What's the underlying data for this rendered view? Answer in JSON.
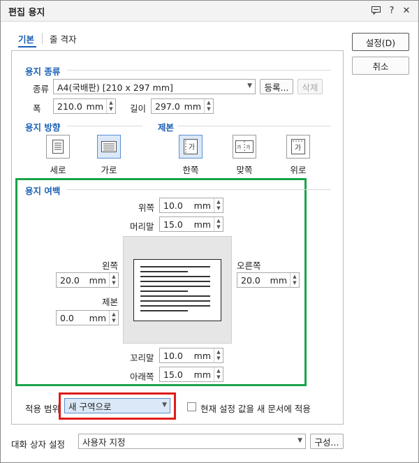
{
  "window": {
    "title": "편집 용지"
  },
  "titlebar_buttons": {
    "help": "?",
    "close": "✕"
  },
  "tabs": [
    {
      "label": "기본"
    },
    {
      "label": "줄 격자"
    }
  ],
  "paper_type": {
    "section": "용지 종류",
    "type_label": "종류",
    "type_value": "A4(국배판)  [210 x 297 mm]",
    "register_button": "등록...",
    "delete_button": "삭제",
    "width_label": "폭",
    "width_value": "210.0",
    "height_label": "길이",
    "height_value": "297.0",
    "unit": "mm"
  },
  "orientation": {
    "section": "용지 방향",
    "portrait": "세로",
    "landscape": "가로",
    "selected": "landscape"
  },
  "binding": {
    "section": "제본",
    "options": [
      {
        "label": "한쪽",
        "glyph": "가"
      },
      {
        "label": "맞쪽",
        "glyph": "가|가"
      },
      {
        "label": "위로",
        "glyph": "가"
      }
    ],
    "selected": "한쪽"
  },
  "margins": {
    "section": "용지 여백",
    "top_label": "위쪽",
    "top_value": "10.0",
    "header_label": "머리말",
    "header_value": "15.0",
    "left_label": "왼쪽",
    "left_value": "20.0",
    "gutter_label": "제본",
    "gutter_value": "0.0",
    "right_label": "오른쪽",
    "right_value": "20.0",
    "footer_label": "꼬리말",
    "footer_value": "10.0",
    "bottom_label": "아래쪽",
    "bottom_value": "15.0",
    "unit": "mm"
  },
  "apply": {
    "label": "적용 범위",
    "value": "새 구역으로",
    "checkbox_label": "현재 설정 값을 새 문서에 적용",
    "checked": false
  },
  "dialog_settings": {
    "label": "대화 상자 설정",
    "value": "사용자 지정",
    "config_button": "구성..."
  },
  "buttons": {
    "ok": "설정(D)",
    "cancel": "취소"
  },
  "colors": {
    "accent": "#1a5fb4",
    "highlight_green": "#1aa34a",
    "highlight_red": "#e01b1b"
  }
}
